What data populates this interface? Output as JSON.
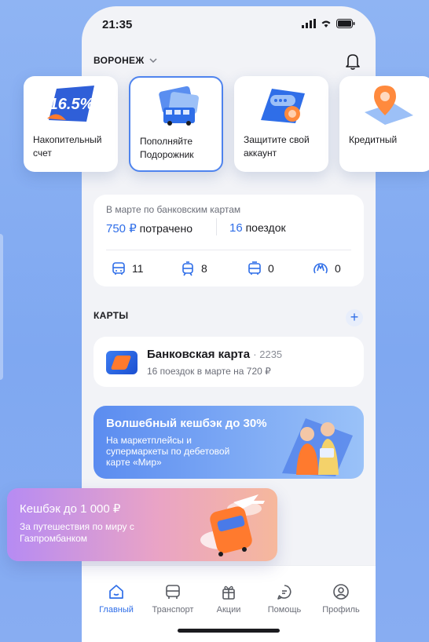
{
  "status_bar": {
    "time": "21:35"
  },
  "header": {
    "city": "ВОРОНЕЖ"
  },
  "promos": [
    {
      "label": "Накопительный счет",
      "badge": "16.5%"
    },
    {
      "label": "Пополняйте Подорожник"
    },
    {
      "label": "Защитите свой аккаунт"
    },
    {
      "label": "Кредитный"
    }
  ],
  "stats": {
    "label": "В марте по банковским картам",
    "spent_value": "750 ₽",
    "spent_suffix": "потрачено",
    "trips_value": "16",
    "trips_suffix": "поездок",
    "transport": [
      {
        "icon": "trolleybus-icon",
        "count": "11"
      },
      {
        "icon": "tram-icon",
        "count": "8"
      },
      {
        "icon": "bus-icon",
        "count": "0"
      },
      {
        "icon": "metro-icon",
        "count": "0"
      }
    ]
  },
  "cards": {
    "title": "КАРТЫ",
    "items": [
      {
        "name": "Банковская карта",
        "number": "· 2235",
        "subtitle": "16 поездок в марте на 720 ₽"
      }
    ]
  },
  "banner": {
    "title": "Волшебный кешбэк до 30%",
    "subtitle": "На маркетплейсы и супермаркеты по дебетовой карте «Мир»"
  },
  "float_banner": {
    "title": "Кешбэк до 1 000 ₽",
    "subtitle": "За путешествия по миру с Газпромбанком"
  },
  "tabs": [
    {
      "label": "Главный",
      "active": true
    },
    {
      "label": "Транспорт"
    },
    {
      "label": "Акции"
    },
    {
      "label": "Помощь"
    },
    {
      "label": "Профиль"
    }
  ],
  "colors": {
    "accent": "#2f6ee8",
    "background": "#8fb4f3"
  }
}
